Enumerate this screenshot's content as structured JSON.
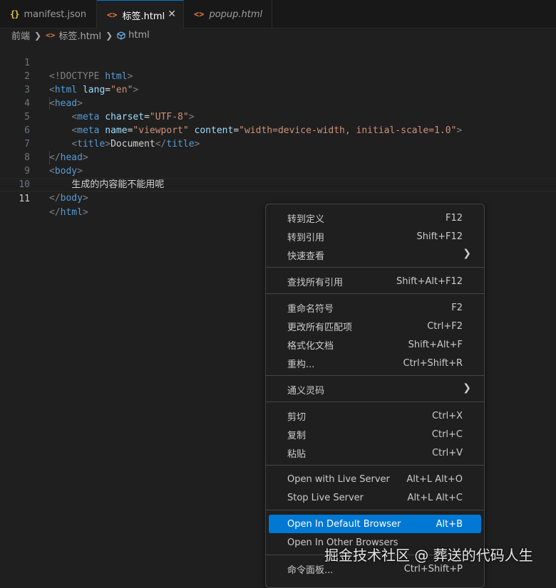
{
  "tabs": [
    {
      "label": "manifest.json",
      "icon": "json-icon"
    },
    {
      "label": "标签.html",
      "icon": "html-icon",
      "active": true
    },
    {
      "label": "popup.html",
      "icon": "html-icon"
    }
  ],
  "breadcrumb": {
    "root": "前端",
    "file": "标签.html",
    "symbol": "html"
  },
  "editor": {
    "current_line": 11,
    "lines": [
      {
        "n": "1"
      },
      {
        "n": "2"
      },
      {
        "n": "3"
      },
      {
        "n": "4"
      },
      {
        "n": "5"
      },
      {
        "n": "6"
      },
      {
        "n": "7"
      },
      {
        "n": "8"
      },
      {
        "n": "9"
      },
      {
        "n": "10"
      },
      {
        "n": "11"
      }
    ],
    "code": {
      "doctype_open": "<!DOCTYPE",
      "doctype_name": "html",
      "doctype_close": ">",
      "html_tag": "html",
      "lang_attr": "lang",
      "lang_val": "\"en\"",
      "head_tag": "head",
      "meta_tag": "meta",
      "charset_attr": "charset",
      "charset_val": "\"UTF-8\"",
      "name_attr": "name",
      "name_val": "\"viewport\"",
      "content_attr": "content",
      "content_val": "\"width=device-width, initial-scale=1.0\"",
      "title_tag": "title",
      "title_text": "Document",
      "body_tag": "body",
      "body_text": "生成的内容能不能用呢"
    }
  },
  "context_menu": {
    "items": [
      {
        "label": "转到定义",
        "key": "F12"
      },
      {
        "label": "转到引用",
        "key": "Shift+F12"
      },
      {
        "label": "快速查看",
        "submenu": true
      },
      {
        "label": "查找所有引用",
        "key": "Shift+Alt+F12"
      },
      {
        "label": "重命名符号",
        "key": "F2"
      },
      {
        "label": "更改所有匹配项",
        "key": "Ctrl+F2"
      },
      {
        "label": "格式化文档",
        "key": "Shift+Alt+F"
      },
      {
        "label": "重构...",
        "key": "Ctrl+Shift+R"
      },
      {
        "label": "通义灵码",
        "submenu": true
      },
      {
        "label": "剪切",
        "key": "Ctrl+X"
      },
      {
        "label": "复制",
        "key": "Ctrl+C"
      },
      {
        "label": "粘贴",
        "key": "Ctrl+V"
      },
      {
        "label": "Open with Live Server",
        "key": "Alt+L Alt+O"
      },
      {
        "label": "Stop Live Server",
        "key": "Alt+L Alt+C"
      },
      {
        "label": "Open In Default Browser",
        "key": "Alt+B",
        "selected": true
      },
      {
        "label": "Open In Other Browsers",
        "key": ""
      },
      {
        "label": "命令面板...",
        "key": "Ctrl+Shift+P"
      }
    ]
  },
  "watermark": "掘金技术社区 @ 葬送的代码人生",
  "colors": {
    "background": "#1f1f1f",
    "accent": "#0078d4",
    "tag": "#569cd6",
    "attribute": "#9cdcfe",
    "string": "#ce9178"
  }
}
